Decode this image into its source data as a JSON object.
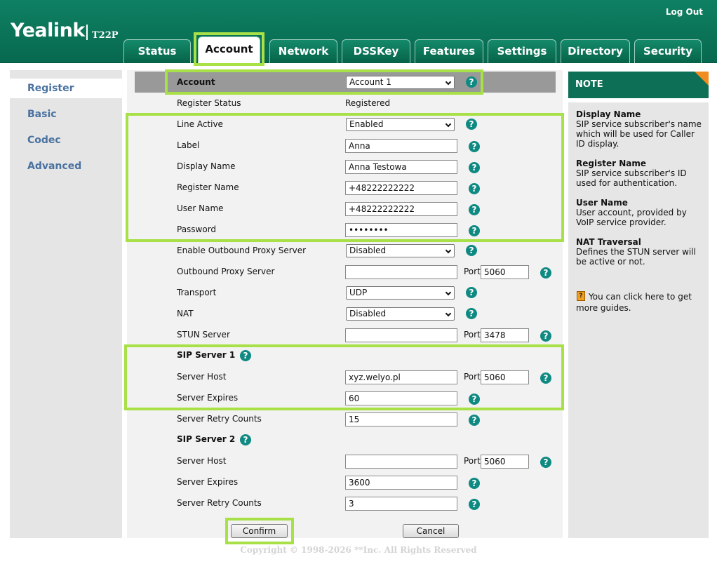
{
  "brand": {
    "logo": "Yealink",
    "model": "T22P"
  },
  "header": {
    "logout": "Log Out"
  },
  "tabs": [
    {
      "label": "Status"
    },
    {
      "label": "Account"
    },
    {
      "label": "Network"
    },
    {
      "label": "DSSKey"
    },
    {
      "label": "Features"
    },
    {
      "label": "Settings"
    },
    {
      "label": "Directory"
    },
    {
      "label": "Security"
    }
  ],
  "active_tab": "Account",
  "sidebar": {
    "items": [
      {
        "label": "Register"
      },
      {
        "label": "Basic"
      },
      {
        "label": "Codec"
      },
      {
        "label": "Advanced"
      }
    ],
    "active": "Register"
  },
  "form": {
    "account": {
      "label": "Account",
      "value": "Account 1"
    },
    "register_status": {
      "label": "Register Status",
      "value": "Registered"
    },
    "line_active": {
      "label": "Line Active",
      "value": "Enabled"
    },
    "label": {
      "label": "Label",
      "value": "Anna"
    },
    "display_name": {
      "label": "Display Name",
      "value": "Anna Testowa"
    },
    "register_name": {
      "label": "Register Name",
      "value": "+48222222222"
    },
    "user_name": {
      "label": "User Name",
      "value": "+48222222222"
    },
    "password": {
      "label": "Password",
      "value": "••••••••"
    },
    "outbound_enable": {
      "label": "Enable Outbound Proxy Server",
      "value": "Disabled"
    },
    "outbound_server": {
      "label": "Outbound Proxy Server",
      "value": "",
      "port_label": "Port",
      "port": "5060"
    },
    "transport": {
      "label": "Transport",
      "value": "UDP"
    },
    "nat": {
      "label": "NAT",
      "value": "Disabled"
    },
    "stun": {
      "label": "STUN Server",
      "value": "",
      "port_label": "Port",
      "port": "3478"
    },
    "sip1": {
      "title": "SIP Server 1",
      "host": {
        "label": "Server Host",
        "value": "xyz.welyo.pl",
        "port_label": "Port",
        "port": "5060"
      },
      "expires": {
        "label": "Server Expires",
        "value": "60"
      },
      "retry": {
        "label": "Server Retry Counts",
        "value": "15"
      }
    },
    "sip2": {
      "title": "SIP Server 2",
      "host": {
        "label": "Server Host",
        "value": "",
        "port_label": "Port",
        "port": "5060"
      },
      "expires": {
        "label": "Server Expires",
        "value": "3600"
      },
      "retry": {
        "label": "Server Retry Counts",
        "value": "3"
      }
    },
    "buttons": {
      "confirm": "Confirm",
      "cancel": "Cancel"
    },
    "help_glyph": "?"
  },
  "note": {
    "title": "NOTE",
    "items": [
      {
        "title": "Display Name",
        "text": "SIP service subscriber's name which will be used for Caller ID display."
      },
      {
        "title": "Register Name",
        "text": "SIP service subscriber's ID used for authentication."
      },
      {
        "title": "User Name",
        "text": "User account, provided by VoIP service provider."
      },
      {
        "title": "NAT Traversal",
        "text": "Defines the STUN server will be active or not."
      }
    ],
    "guide": "You can click here to get more guides."
  },
  "footer": {
    "copyright": "Copyright © 1998-2026 **Inc. All Rights Reserved"
  },
  "colors": {
    "header_green": "#0f8063",
    "highlight": "#a8e047",
    "help_teal": "#0f8a82",
    "note_corner": "#f08c20"
  }
}
